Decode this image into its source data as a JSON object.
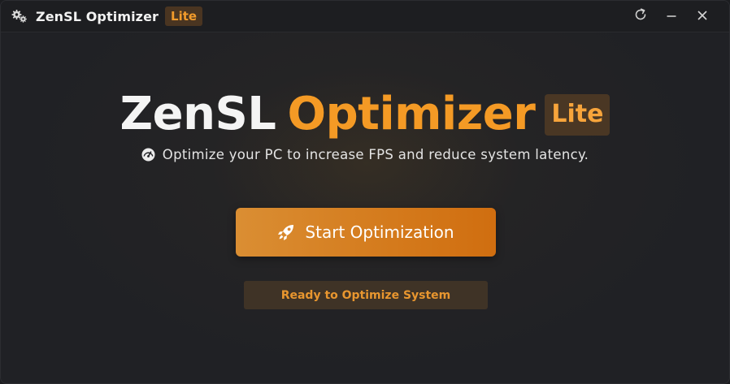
{
  "window": {
    "title": "ZenSL Optimizer",
    "badge": "Lite",
    "icons": {
      "app": "gears-icon",
      "refresh": "refresh-icon",
      "minimize": "minimize-icon",
      "close": "close-icon"
    }
  },
  "hero": {
    "name": "ZenSL",
    "accent": "Optimizer",
    "badge": "Lite",
    "subtitle": "Optimize your PC to increase FPS and reduce system latency.",
    "subtitle_icon": "speedometer-icon"
  },
  "actions": {
    "start_label": "Start Optimization",
    "start_icon": "rocket-icon"
  },
  "status": {
    "text": "Ready to Optimize System"
  },
  "colors": {
    "accent": "#f49a25",
    "button": "#d47a1c",
    "background": "#202125",
    "badge_bg": "#4a3724",
    "status_bg": "#3f3326"
  }
}
